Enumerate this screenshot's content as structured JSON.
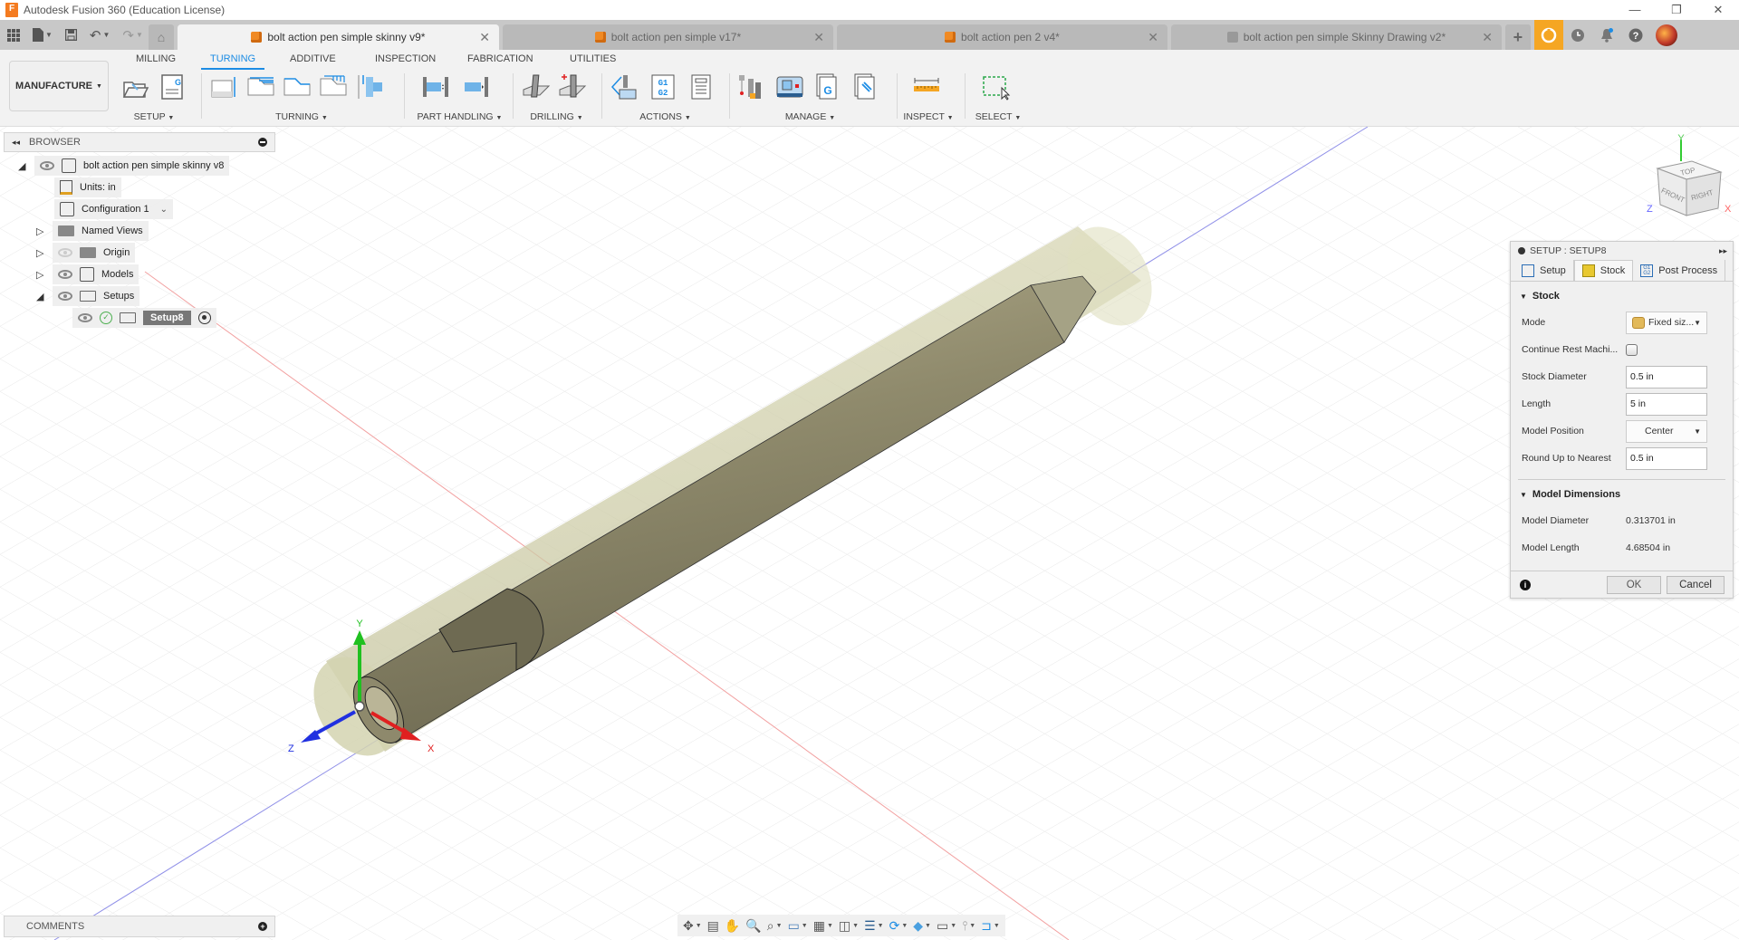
{
  "app": {
    "title": "Autodesk Fusion 360 (Education License)",
    "logo_letter": "F",
    "window_controls": {
      "minimize": "—",
      "restore": "❐",
      "close": "✕"
    }
  },
  "quick_access": {
    "data_panel_icon": "grid-icon",
    "file_icon": "file-icon",
    "save_icon": "save-icon",
    "undo_icon": "undo-icon",
    "redo_icon": "redo-icon",
    "home_icon": "home-icon"
  },
  "tabs": [
    {
      "label": "bolt action pen simple skinny v9*",
      "active": true,
      "icon": "design-icon"
    },
    {
      "label": "bolt action pen simple v17*",
      "active": false,
      "icon": "design-icon"
    },
    {
      "label": "bolt action pen 2 v4*",
      "active": false,
      "icon": "design-icon"
    },
    {
      "label": "bolt action pen simple Skinny Drawing v2*",
      "active": false,
      "icon": "drawing-icon"
    }
  ],
  "tab_close": "✕",
  "tab_plus": "+",
  "ribbon": {
    "workspace": "MANUFACTURE",
    "tabs": [
      "MILLING",
      "TURNING",
      "ADDITIVE",
      "INSPECTION",
      "FABRICATION",
      "UTILITIES"
    ],
    "active_tab": "TURNING",
    "groups": [
      {
        "label": "SETUP",
        "icons": [
          "new-setup-icon",
          "nc-program-icon"
        ]
      },
      {
        "label": "TURNING",
        "icons": [
          "turning-face-icon",
          "turning-profile-roughing-icon",
          "turning-profile-finishing-icon",
          "turning-groove-icon",
          "turning-part-icon"
        ]
      },
      {
        "label": "PART HANDLING",
        "icons": [
          "part-transfer-icon",
          "bar-pull-icon"
        ]
      },
      {
        "label": "DRILLING",
        "icons": [
          "drilling-icon",
          "hole-recognition-icon"
        ]
      },
      {
        "label": "ACTIONS",
        "icons": [
          "simulate-icon",
          "post-process-icon",
          "setup-sheet-icon"
        ]
      },
      {
        "label": "MANAGE",
        "icons": [
          "tool-library-icon",
          "machine-library-icon",
          "post-library-icon",
          "template-library-icon"
        ]
      },
      {
        "label": "INSPECT",
        "icons": [
          "measure-icon"
        ]
      },
      {
        "label": "SELECT",
        "icons": [
          "window-select-icon"
        ]
      }
    ]
  },
  "browser": {
    "title": "BROWSER",
    "nodes": [
      {
        "label": "bolt action pen simple skinny v8",
        "expanded": true,
        "visible": true
      },
      {
        "label": "Units: in"
      },
      {
        "label": "Configuration 1"
      },
      {
        "label": "Named Views",
        "expanded": false
      },
      {
        "label": "Origin",
        "expanded": false,
        "visible": false
      },
      {
        "label": "Models",
        "expanded": false,
        "visible": true
      },
      {
        "label": "Setups",
        "expanded": true,
        "visible": true
      },
      {
        "label": "Setup8",
        "visible": true,
        "selected": true
      }
    ]
  },
  "comments": {
    "title": "COMMENTS"
  },
  "viewcube": {
    "top": "TOP",
    "front": "FRONT",
    "right": "RIGHT",
    "x": "X",
    "y": "Y",
    "z": "Z"
  },
  "triad": {
    "x": "X",
    "y": "Y",
    "z": "Z"
  },
  "setup_dialog": {
    "title": "SETUP : SETUP8",
    "tabs": [
      {
        "label": "Setup",
        "active": false
      },
      {
        "label": "Stock",
        "active": true
      },
      {
        "label": "Post Process",
        "active": false
      }
    ],
    "stock_section": "Stock",
    "fields": {
      "mode": {
        "label": "Mode",
        "value": "Fixed siz..."
      },
      "continue_rest": {
        "label": "Continue Rest Machi...",
        "checked": false
      },
      "stock_diameter": {
        "label": "Stock Diameter",
        "value": "0.5 in"
      },
      "length": {
        "label": "Length",
        "value": "5 in"
      },
      "model_position": {
        "label": "Model Position",
        "value": "Center"
      },
      "round_up": {
        "label": "Round Up to Nearest",
        "value": "0.5 in"
      }
    },
    "model_dims_section": "Model Dimensions",
    "model_dims": {
      "diameter": {
        "label": "Model Diameter",
        "value": "0.313701 in"
      },
      "length": {
        "label": "Model Length",
        "value": "4.68504 in"
      }
    },
    "ok": "OK",
    "cancel": "Cancel"
  },
  "nav_toolbar": [
    "orbit-icon",
    "look-at-icon",
    "pan-icon",
    "zoom-icon",
    "fit-icon",
    "display-settings-icon",
    "grid-icon",
    "visual-style-icon",
    "layers-icon",
    "refresh-icon",
    "environment-icon",
    "machine-icon",
    "tool-icon",
    "toolpath-icon"
  ],
  "colors": {
    "accent": "#1c8ce4",
    "job_status": "#f5a623",
    "stock": "#c8c8a0",
    "model": "#9a9577",
    "axis_x": "#e02020",
    "axis_y": "#20c020",
    "axis_z": "#2030e0"
  }
}
